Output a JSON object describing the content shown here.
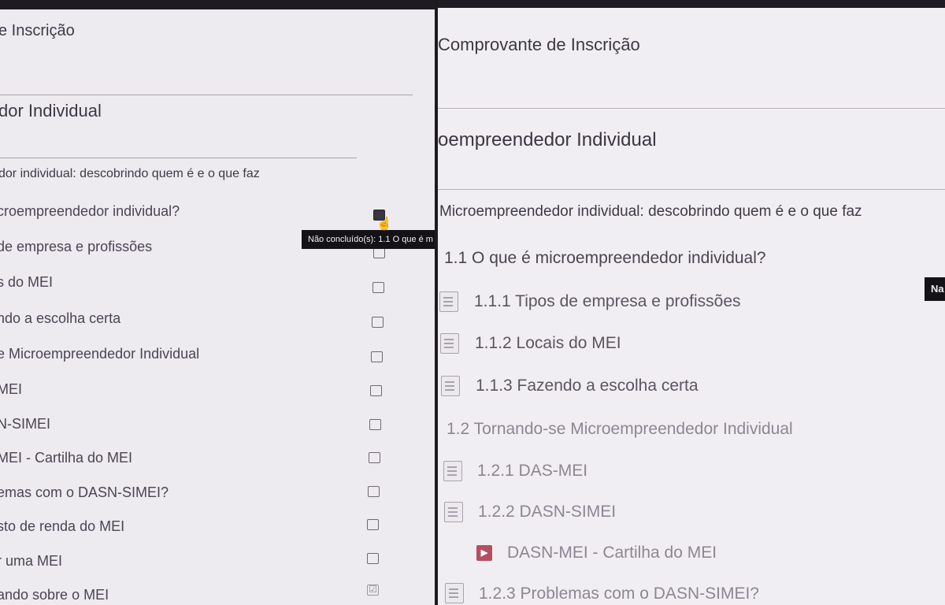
{
  "left": {
    "title": "e Inscrição",
    "course": "dor Individual",
    "section": "dor individual: descobrindo quem é e o que faz",
    "rows": [
      {
        "label": "croempreendedor individual?",
        "state": "active"
      },
      {
        "label": "de empresa e profissões",
        "state": "open"
      },
      {
        "label": "s do MEI",
        "state": "open"
      },
      {
        "label": "ndo a escolha certa",
        "state": "open"
      },
      {
        "label": "e Microempreendedor Individual",
        "state": "open"
      },
      {
        "label": "MEI",
        "state": "open"
      },
      {
        "label": "N-SIMEI",
        "state": "open"
      },
      {
        "label": "MEI - Cartilha do MEI",
        "state": "open"
      },
      {
        "label": "emas com o DASN-SIMEI?",
        "state": "open"
      },
      {
        "label": "sto de renda do MEI",
        "state": "open"
      },
      {
        "label": "r uma MEI",
        "state": "open"
      },
      {
        "label": "ando sobre o MEI",
        "state": "checked"
      }
    ],
    "tooltip": "Não concluído(s): 1.1 O que é m",
    "checked_mark": "☑"
  },
  "right": {
    "title": "Comprovante de Inscrição",
    "course": "oempreendedor Individual",
    "section": "Microempreendedor individual: descobrindo quem é e o que faz",
    "items": [
      {
        "label": "1.1 O que é microempreendedor individual?",
        "icon": "none"
      },
      {
        "label": "1.1.1 Tipos de empresa e profissões",
        "icon": "page"
      },
      {
        "label": "1.1.2 Locais do MEI",
        "icon": "page"
      },
      {
        "label": "1.1.3 Fazendo a escolha certa",
        "icon": "page"
      },
      {
        "label": "1.2 Tornando-se Microempreendedor Individual",
        "icon": "none"
      },
      {
        "label": "1.2.1 DAS-MEI",
        "icon": "page"
      },
      {
        "label": "1.2.2 DASN-SIMEI",
        "icon": "page"
      },
      {
        "label": "DASN-MEI - Cartilha do MEI",
        "icon": "pdf"
      },
      {
        "label": "1.2.3 Problemas com o DASN-SIMEI?",
        "icon": "page"
      }
    ],
    "side_tip": "Na"
  },
  "colors": {
    "tooltip_bg": "#141216",
    "pdf_icon": "#b44f5e"
  }
}
